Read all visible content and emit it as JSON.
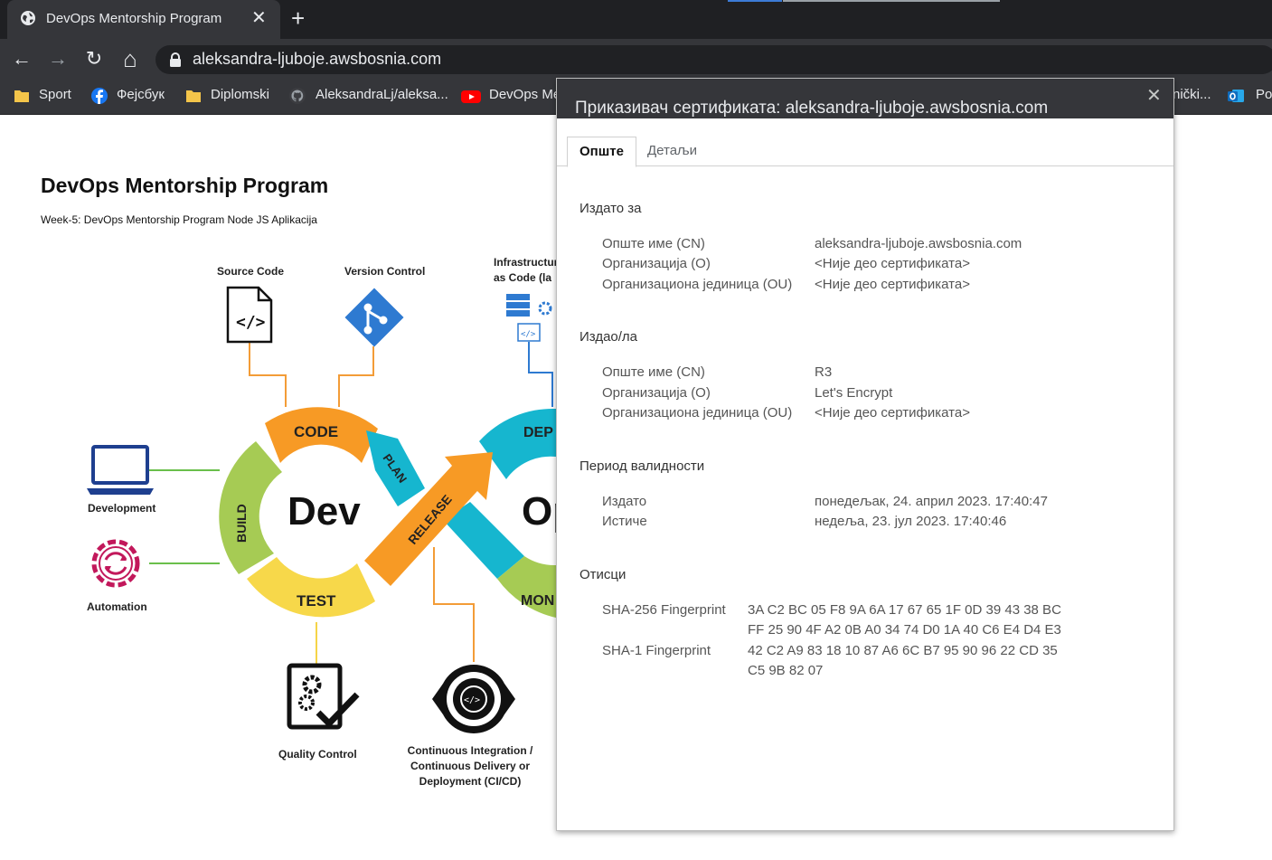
{
  "browser": {
    "tab_title": "DevOps Mentorship Program",
    "tab_close": "✕",
    "new_tab": "+",
    "url": "aleksandra-ljuboje.awsbosnia.com",
    "nav": {
      "back": "←",
      "forward": "→",
      "reload": "↻",
      "home": "⌂"
    },
    "bookmarks": [
      {
        "label": "Sport",
        "icon": "folder-icon"
      },
      {
        "label": "Фејсбук",
        "icon": "facebook-icon"
      },
      {
        "label": "Diplomski",
        "icon": "folder-icon"
      },
      {
        "label": "AleksandraLj/aleksa...",
        "icon": "github-icon"
      },
      {
        "label": "DevOps Me",
        "icon": "youtube-icon"
      }
    ],
    "bookmarks_right": [
      "nički...",
      "Po"
    ],
    "colors": {
      "tabstrip": "#1f2023",
      "toolbar": "#35363a",
      "omnibox": "#202124"
    }
  },
  "page": {
    "title": "DevOps Mentorship Program",
    "subtitle": "Week-5: DevOps Mentorship Program Node JS Aplikacija",
    "diagram": {
      "labels": {
        "source_code": "Source Code",
        "version_control": "Version Control",
        "iac": "Infrastructure as Code (la",
        "development": "Development",
        "automation": "Automation",
        "quality_control": "Quality Control",
        "cicd": "Continuous Integration / Continuous Delivery or Deployment (CI/CD)"
      },
      "loop_words": {
        "code": "CODE",
        "plan": "PLAN",
        "build": "BUILD",
        "test": "TEST",
        "release": "RELEASE",
        "deploy": "DEP",
        "monitor": "MON",
        "dev": "Dev",
        "ops": "Op"
      }
    }
  },
  "cert_viewer": {
    "title": "Приказивач сертификата: aleksandra-ljuboje.awsbosnia.com",
    "close": "✕",
    "tabs": {
      "general": "Опште",
      "details": "Детаљи"
    },
    "issued_to": {
      "heading": "Издато за",
      "cn_label": "Опште име (CN)",
      "cn_value": "aleksandra-ljuboje.awsbosnia.com",
      "o_label": "Организација (O)",
      "o_value": "<Није део сертификата>",
      "ou_label": "Организациона јединица (OU)",
      "ou_value": "<Није део сертификата>"
    },
    "issued_by": {
      "heading": "Издао/ла",
      "cn_label": "Опште име (CN)",
      "cn_value": "R3",
      "o_label": "Организација (O)",
      "o_value": "Let's Encrypt",
      "ou_label": "Организациона јединица (OU)",
      "ou_value": "<Није део сертификата>"
    },
    "validity": {
      "heading": "Период валидности",
      "issued_label": "Издато",
      "issued_value": "понедељак, 24. април 2023. 17:40:47",
      "expires_label": "Истиче",
      "expires_value": "недеља, 23. јул 2023. 17:40:46"
    },
    "fingerprints": {
      "heading": "Отисци",
      "sha256_label": "SHA-256 Fingerprint",
      "sha256_line1": "3A C2 BC 05 F8 9A 6A 17 67 65 1F 0D 39 43 38 BC",
      "sha256_line2": "FF 25 90 4F A2 0B A0 34 74 D0 1A 40 C6 E4 D4 E3",
      "sha1_label": "SHA-1 Fingerprint",
      "sha1_line1": "42 C2 A9 83 18 10 87 A6 6C B7 95 90 96 22 CD 35",
      "sha1_line2": "C5 9B 82 07"
    }
  }
}
